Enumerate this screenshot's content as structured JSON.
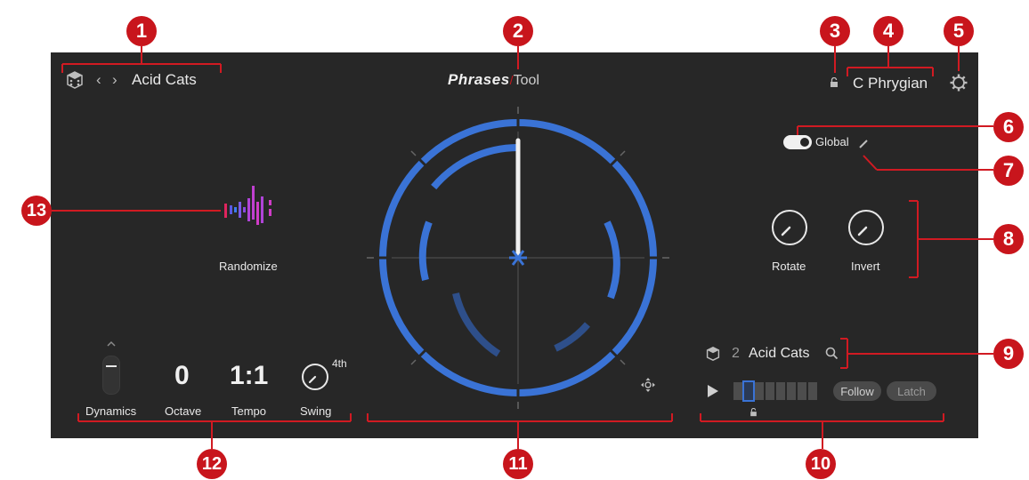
{
  "header": {
    "preset_name": "Acid Cats",
    "logo_main": "Phrases",
    "logo_suffix": "Tool",
    "scale_root": "C",
    "scale_mode": "Phrygian"
  },
  "global": {
    "label": "Global",
    "toggle_on": true
  },
  "knobs": {
    "rotate": "Rotate",
    "invert": "Invert"
  },
  "randomize": {
    "label": "Randomize"
  },
  "params": {
    "dynamics_label": "Dynamics",
    "octave_value": "0",
    "octave_label": "Octave",
    "tempo_value": "1:1",
    "tempo_label": "Tempo",
    "swing_value": "4th",
    "swing_label": "Swing"
  },
  "phrase": {
    "number": "2",
    "name": "Acid Cats"
  },
  "transport": {
    "follow": "Follow",
    "latch": "Latch",
    "selected_slot": 2,
    "slot_count": 8
  },
  "callouts": [
    "1",
    "2",
    "3",
    "4",
    "5",
    "6",
    "7",
    "8",
    "9",
    "10",
    "11",
    "12",
    "13"
  ],
  "colors": {
    "accent": "#3a73d6",
    "panel": "#272727",
    "callout": "#c8151c",
    "bracket": "#d11a22"
  }
}
